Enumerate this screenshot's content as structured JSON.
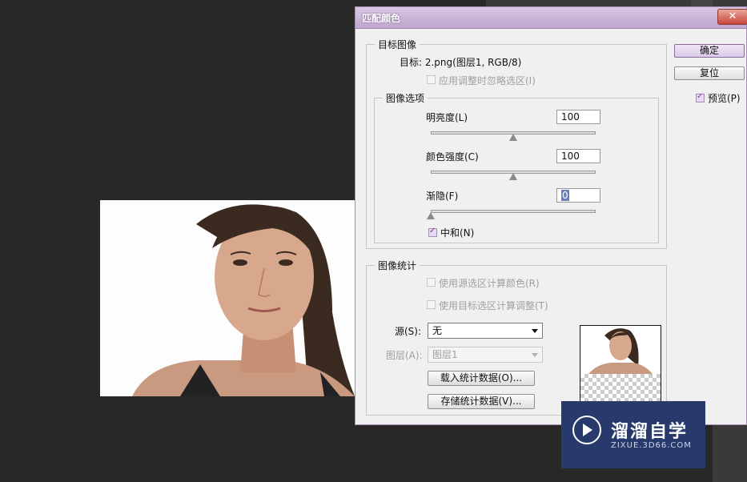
{
  "dialog": {
    "title": "匹配颜色",
    "close_label": "✕",
    "ok_label": "确定",
    "reset_label": "复位",
    "preview_label": "预览(P)",
    "target_group": {
      "label": "目标图像",
      "target_text": "目标: 2.png(图层1, RGB/8)",
      "ignore_selection_label": "应用调整时忽略选区(I)"
    },
    "options_group": {
      "label": "图像选项",
      "luminance_label": "明亮度(L)",
      "luminance_value": "100",
      "intensity_label": "颜色强度(C)",
      "intensity_value": "100",
      "fade_label": "渐隐(F)",
      "fade_value": "0",
      "neutralize_label": "中和(N)"
    },
    "stats_group": {
      "label": "图像统计",
      "use_source_selection_label": "使用源选区计算颜色(R)",
      "use_target_selection_label": "使用目标选区计算调整(T)",
      "source_label": "源(S):",
      "source_value": "无",
      "layer_label": "图层(A):",
      "layer_value": "图层1",
      "load_stats_label": "载入统计数据(O)...",
      "save_stats_label": "存储统计数据(V)..."
    }
  },
  "sliders": {
    "luminance": 0.5,
    "intensity": 0.5,
    "fade": 0.0
  },
  "watermark": {
    "name": "溜溜自学",
    "url": "ZIXUE.3D66.COM"
  },
  "colors": {
    "dialog_accent": "#bfa6cd",
    "annotation": "#e03030",
    "watermark_bg": "#273a6b"
  }
}
